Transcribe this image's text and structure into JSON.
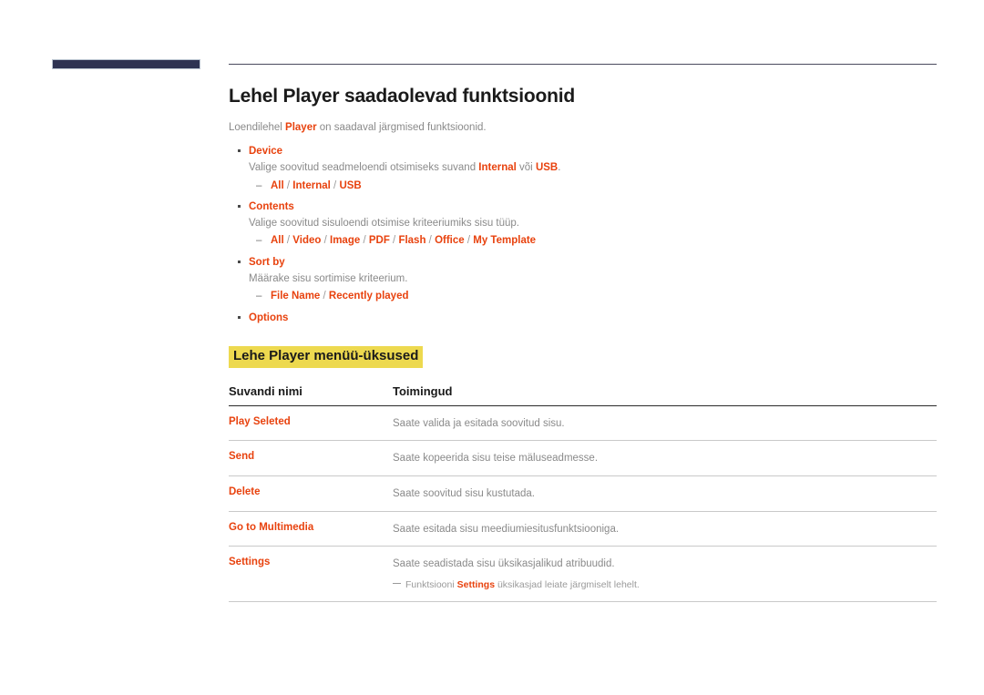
{
  "header": {
    "bar_color": "#2e3352",
    "rule_color": "#4a4a5e"
  },
  "accent_color": "#e8420e",
  "highlight_color": "#edd94f",
  "main": {
    "title": "Lehel Player saadaolevad funktsioonid",
    "intro": {
      "before": "Loendilehel ",
      "term": "Player",
      "after": " on saadaval järgmised funktsioonid."
    },
    "bullets": [
      {
        "title": "Device",
        "desc_before": "Valige soovitud seadmeloendi otsimiseks suvand ",
        "desc_term1": "Internal",
        "desc_mid": " või ",
        "desc_term2": "USB",
        "desc_after": ".",
        "options": [
          "All",
          "Internal",
          "USB"
        ]
      },
      {
        "title": "Contents",
        "desc_before": "Valige soovitud sisuloendi otsimise kriteeriumiks sisu tüüp.",
        "desc_term1": "",
        "desc_mid": "",
        "desc_term2": "",
        "desc_after": "",
        "options": [
          "All",
          "Video",
          "Image",
          "PDF",
          "Flash",
          "Office",
          "My Template"
        ]
      },
      {
        "title": "Sort by",
        "desc_before": "Määrake sisu sortimise kriteerium.",
        "desc_term1": "",
        "desc_mid": "",
        "desc_term2": "",
        "desc_after": "",
        "options": [
          "File Name",
          "Recently played"
        ]
      },
      {
        "title": "Options",
        "desc_before": "",
        "desc_term1": "",
        "desc_mid": "",
        "desc_term2": "",
        "desc_after": "",
        "options": []
      }
    ],
    "sub_heading": "Lehe Player menüü-üksused",
    "table": {
      "columns": [
        "Suvandi nimi",
        "Toimingud"
      ],
      "rows": [
        {
          "name": "Play Seleted",
          "action": "Saate valida ja esitada soovitud sisu.",
          "note": null
        },
        {
          "name": "Send",
          "action": "Saate kopeerida sisu teise mäluseadmesse.",
          "note": null
        },
        {
          "name": "Delete",
          "action": "Saate soovitud sisu kustutada.",
          "note": null
        },
        {
          "name": "Go to Multimedia",
          "action": "Saate esitada sisu meediumiesitusfunktsiooniga.",
          "note": null
        },
        {
          "name": "Settings",
          "action": "Saate seadistada sisu üksikasjalikud atribuudid.",
          "note": {
            "before": "Funktsiooni ",
            "term": "Settings",
            "after": " üksikasjad leiate järgmiselt lehelt."
          }
        }
      ]
    }
  }
}
